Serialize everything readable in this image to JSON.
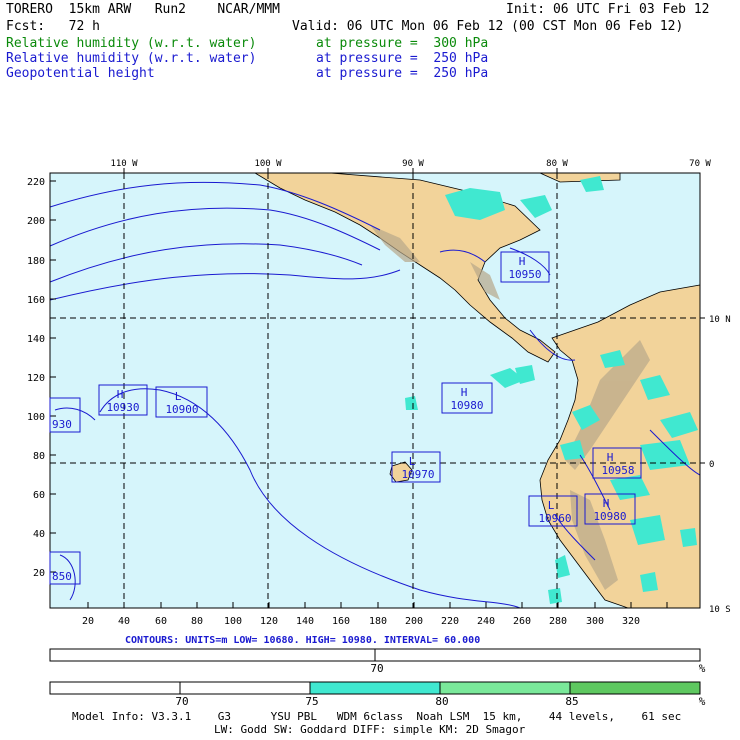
{
  "header": {
    "model": "TORERO  15km ARW   Run2    NCAR/MMM",
    "init": "Init: 06 UTC Fri 03 Feb 12",
    "fcst": "Fcst:   72 h",
    "valid": "Valid: 06 UTC Mon 06 Feb 12 (00 CST Mon 06 Feb 12)",
    "fields": [
      {
        "name": "Relative humidity (w.r.t. water)",
        "level": "at pressure =  300 hPa",
        "color": "#0a8a0a"
      },
      {
        "name": "Relative humidity (w.r.t. water)",
        "level": "at pressure =  250 hPa",
        "color": "#1a1ad0"
      },
      {
        "name": "Geopotential height",
        "level": "at pressure =  250 hPa",
        "color": "#1a1ad0"
      }
    ]
  },
  "map": {
    "lon_labels": [
      "110 W",
      "100 W",
      "90 W",
      "80 W",
      "70 W"
    ],
    "lat_labels": [
      "10 N",
      "0",
      "10 S"
    ],
    "y_ticks": [
      "220",
      "200",
      "180",
      "160",
      "140",
      "120",
      "100",
      "80",
      "60",
      "40",
      "20"
    ],
    "x_ticks": [
      "20",
      "40",
      "60",
      "80",
      "100",
      "120",
      "140",
      "160",
      "180",
      "200",
      "220",
      "240",
      "260",
      "280",
      "300",
      "320"
    ],
    "colors": {
      "ocean": "#d6f5fb",
      "land": "#f2d39a",
      "rh_high": "#40e8d0",
      "contour": "#1a1ad0",
      "grid": "#000000"
    },
    "pressure_centers": [
      {
        "type": "H",
        "value": "10950"
      },
      {
        "type": "H",
        "value": "10930"
      },
      {
        "type": "L",
        "value": "10900"
      },
      {
        "type": "H",
        "value": "10980"
      },
      {
        "type": "L",
        "value": "10970"
      },
      {
        "type": "H",
        "value": "10958"
      },
      {
        "type": "L",
        "value": "10960"
      },
      {
        "type": "H",
        "value": "10980"
      }
    ],
    "edge_labels": [
      "930",
      "850"
    ]
  },
  "footer": {
    "contour_info": "CONTOURS:  UNITS=m  LOW=   10680.     HIGH=   10980.     INTERVAL=    60.000",
    "bar1": {
      "tick": "70",
      "unit": "%"
    },
    "bar2": {
      "ticks": [
        "70",
        "75",
        "80",
        "85"
      ],
      "unit": "%",
      "segments": [
        {
          "color": "#ffffff"
        },
        {
          "color": "#ffffff"
        },
        {
          "color": "#40e8d0"
        },
        {
          "color": "#7ae89a"
        },
        {
          "color": "#5ec860"
        }
      ]
    },
    "model_info_1": "Model Info: V3.3.1    G3      YSU PBL   WDM 6class  Noah LSM  15 km,    44 levels,    61 sec",
    "model_info_2": "LW: Godd SW: Goddard DIFF: simple KM: 2D Smagor"
  }
}
